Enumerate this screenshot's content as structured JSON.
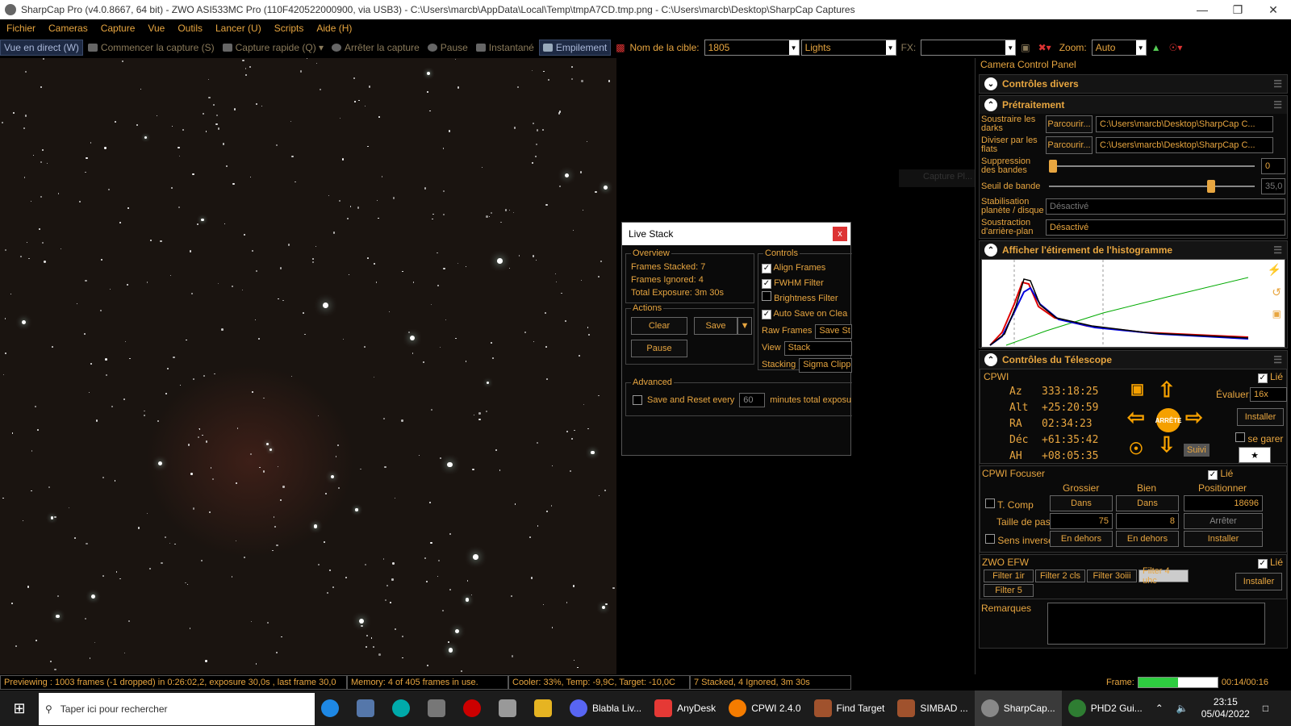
{
  "window": {
    "title": "SharpCap Pro (v4.0.8667, 64 bit) - ZWO ASI533MC Pro (110F420522000900, via USB3) - C:\\Users\\marcb\\AppData\\Local\\Temp\\tmpA7CD.tmp.png - C:\\Users\\marcb\\Desktop\\SharpCap Captures"
  },
  "menu": [
    "Fichier",
    "Cameras",
    "Capture",
    "Vue",
    "Outils",
    "Lancer (U)",
    "Scripts",
    "Aide (H)"
  ],
  "toolbar": {
    "live_view": "Vue en direct (W)",
    "start_capture": "Commencer la capture (S)",
    "quick_capture": "Capture rapide (Q)",
    "stop_capture": "Arrêter la capture",
    "pause": "Pause",
    "snapshot": "Instantané",
    "stacking": "Empilement",
    "target_label": "Nom de la cible:",
    "target_value": "1805",
    "frame_type": "Lights",
    "fx_label": "FX:",
    "zoom_label": "Zoom:",
    "zoom_value": "Auto"
  },
  "ghost_text": "Capture Pl...",
  "live_stack": {
    "title": "Live Stack",
    "close": "x",
    "overview_title": "Overview",
    "frames_stacked": "Frames Stacked: 7",
    "frames_ignored": "Frames Ignored: 4",
    "total_exposure": "Total Exposure: 3m 30s",
    "actions_title": "Actions",
    "clear": "Clear",
    "save": "Save",
    "pause": "Pause",
    "controls_title": "Controls",
    "align_frames": "Align Frames",
    "fwhm_filter": "FWHM Filter",
    "brightness_filter": "Brightness Filter",
    "auto_save": "Auto Save on Clea",
    "raw_frames_label": "Raw Frames",
    "raw_frames_value": "Save St",
    "view_label": "View",
    "view_value": "Stack",
    "stacking_label": "Stacking",
    "stacking_value": "Sigma Clipp",
    "advanced_title": "Advanced",
    "save_reset": "Save and Reset every",
    "minutes_value": "60",
    "minutes_label": "minutes total exposu"
  },
  "panel": {
    "title": "Camera Control Panel",
    "misc_controls": "Contrôles divers",
    "preprocessing": "Prétraitement",
    "subtract_darks": "Soustraire les darks",
    "browse": "Parcourir...",
    "darks_path": "C:\\Users\\marcb\\Desktop\\SharpCap C...",
    "divide_flats": "Diviser par les flats",
    "flats_path": "C:\\Users\\marcb\\Desktop\\SharpCap C...",
    "band_suppression": "Suppression des bandes",
    "band_suppression_value": "0",
    "band_threshold": "Seuil de bande",
    "band_threshold_value": "35,0",
    "stabilization": "Stabilisation planète / disque",
    "stabilization_value": "Désactivé",
    "bg_subtraction": "Soustraction d'arrière-plan",
    "bg_subtraction_value": "Désactivé",
    "histogram": "Afficher l'étirement de l'histogramme",
    "telescope": "Contrôles du Télescope",
    "mount_name": "CPWI",
    "linked": "Lié",
    "az_label": "Az",
    "az_value": "333:18:25",
    "alt_label": "Alt",
    "alt_value": "+25:20:59",
    "ra_label": "RA",
    "ra_value": "02:34:23",
    "dec_label": "Déc",
    "dec_value": "+61:35:42",
    "ha_label": "AH",
    "ha_value": "+08:05:35",
    "rate_label": "Évaluer:",
    "rate_value": "16x",
    "install": "Installer",
    "park": "se garer",
    "track": "Suivi",
    "stop_center": "ARRÊTE",
    "focuser_name": "CPWI Focuser",
    "coarse": "Grossier",
    "fine": "Bien",
    "positioner": "Positionner",
    "tcomp": "T. Comp",
    "in_coarse": "Dans",
    "in_fine": "Dans",
    "position_value": "18696",
    "step_size": "Taille de pas",
    "step_coarse": "75",
    "step_fine": "8",
    "stop": "Arrêter",
    "reverse": "Sens inverse",
    "out_coarse": "En dehors",
    "out_fine": "En dehors",
    "install2": "Installer",
    "efw_name": "ZWO EFW",
    "filters": [
      "Filter 1ir",
      "Filter 2 cls",
      "Filter 3oiii",
      "Filter 4 uhc",
      "Filter 5"
    ],
    "install3": "Installer",
    "notes": "Remarques"
  },
  "status": {
    "preview": "Previewing : 1003 frames (-1 dropped) in 0:26:02,2, exposure 30,0s , last frame 30,0",
    "memory": "Memory: 4 of 405 frames in use.",
    "cooler": "Cooler: 33%, Temp: -9,9C, Target: -10,0C",
    "stack": "7 Stacked, 4 Ignored, 3m 30s",
    "frame_label": "Frame:",
    "frame_time": "00:14/00:16",
    "frame_progress": 0.5
  },
  "taskbar": {
    "search_placeholder": "Taper ici pour rechercher",
    "apps": [
      "Blabla Liv...",
      "AnyDesk",
      "CPWI 2.4.0",
      "Find Target",
      "SIMBAD ...",
      "SharpCap...",
      "PHD2 Gui..."
    ],
    "time": "23:15",
    "date": "05/04/2022"
  },
  "colors": {
    "accent": "#e8a640",
    "panel_bg": "#000000",
    "sky": "#1a1410"
  }
}
